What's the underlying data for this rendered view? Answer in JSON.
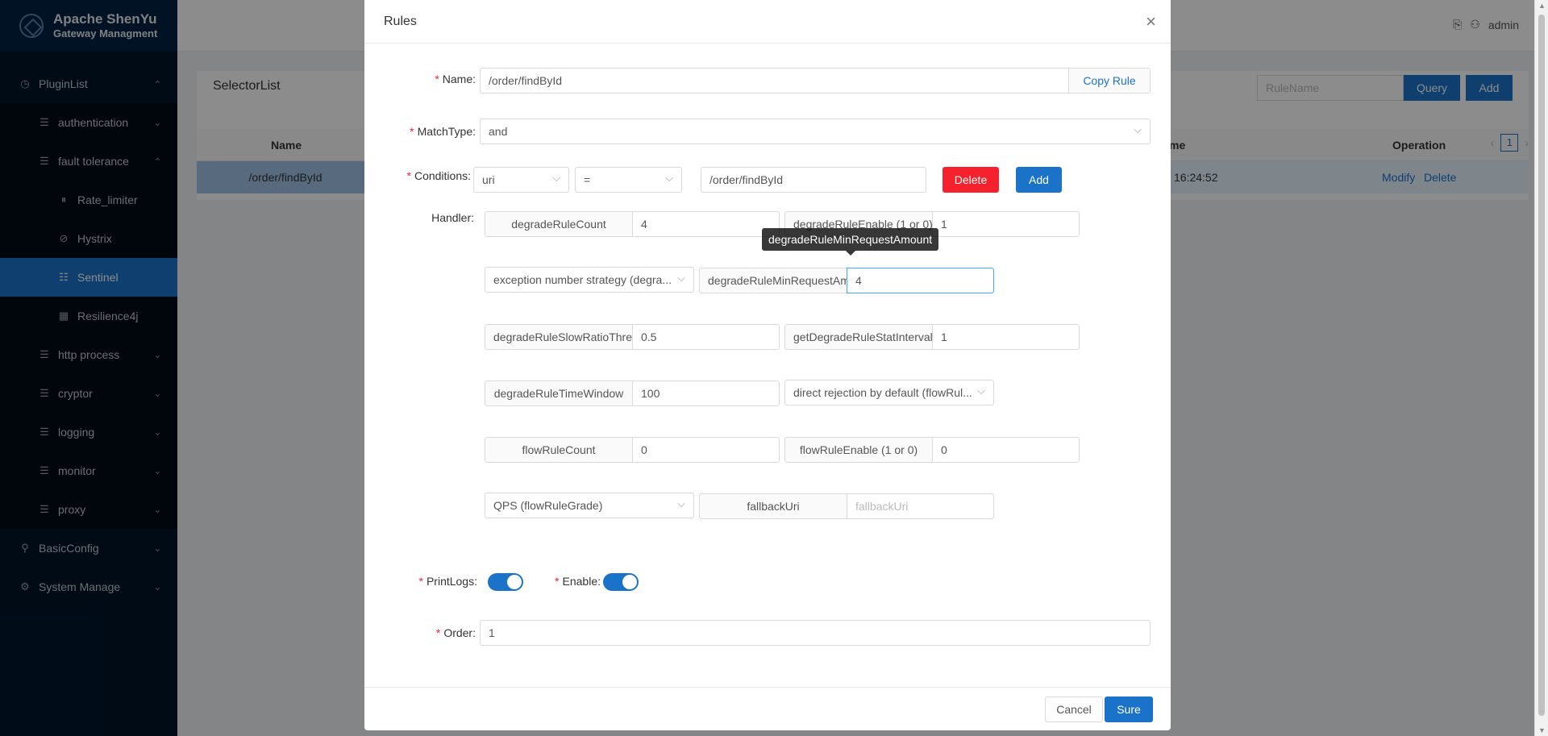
{
  "app": {
    "title_line1": "Apache ShenYu",
    "title_line2": "Gateway Managment"
  },
  "sidebar": {
    "plugin_list": "PluginList",
    "authentication": "authentication",
    "fault_tolerance": "fault tolerance",
    "rate_limiter": "Rate_limiter",
    "hystrix": "Hystrix",
    "sentinel": "Sentinel",
    "resilience4j": "Resilience4j",
    "http_process": "http process",
    "cryptor": "cryptor",
    "logging": "logging",
    "monitor": "monitor",
    "proxy": "proxy",
    "basic_config": "BasicConfig",
    "system_manage": "System Manage"
  },
  "header": {
    "user": "admin"
  },
  "selector": {
    "title": "SelectorList",
    "rule_name_placeholder": "RuleName",
    "query": "Query",
    "add": "Add",
    "col_name": "Name",
    "col_time": "me",
    "col_operation": "Operation",
    "row_name": "/order/findById",
    "row_time": "16:24:52",
    "modify": "Modify",
    "delete": "Delete",
    "page": "1"
  },
  "modal": {
    "title": "Rules",
    "name_label": "Name:",
    "name_value": "/order/findById",
    "copy_rule": "Copy Rule",
    "match_label": "MatchType:",
    "match_value": "and",
    "cond_label": "Conditions:",
    "cond_param": "uri",
    "cond_op": "=",
    "cond_value": "/order/findById",
    "cond_delete": "Delete",
    "cond_add": "Add",
    "handler_label": "Handler:",
    "tooltip": "degradeRuleMinRequestAmount",
    "h_degrade_count_label": "degradeRuleCount",
    "h_degrade_count": "4",
    "h_degrade_enable_label": "degradeRuleEnable (1 or 0)",
    "h_degrade_enable": "1",
    "h_exception_strategy": "exception number strategy (degra...",
    "h_min_request_label": "degradeRuleMinRequestAm",
    "h_min_request": "4",
    "h_slow_ratio_label": "degradeRuleSlowRatioThres",
    "h_slow_ratio": "0.5",
    "h_stat_interval_label": "getDegradeRuleStatInterval:",
    "h_stat_interval": "1",
    "h_time_window_label": "degradeRuleTimeWindow",
    "h_time_window": "100",
    "h_direct_rejection": "direct rejection by default (flowRul...",
    "h_flow_count_label": "flowRuleCount",
    "h_flow_count": "0",
    "h_flow_enable_label": "flowRuleEnable (1 or 0)",
    "h_flow_enable": "0",
    "h_qps": "QPS (flowRuleGrade)",
    "h_fallback_label": "fallbackUri",
    "h_fallback_placeholder": "fallbackUri",
    "print_logs_label": "PrintLogs:",
    "enable_label": "Enable:",
    "order_label": "Order:",
    "order_value": "1",
    "cancel": "Cancel",
    "sure": "Sure"
  }
}
